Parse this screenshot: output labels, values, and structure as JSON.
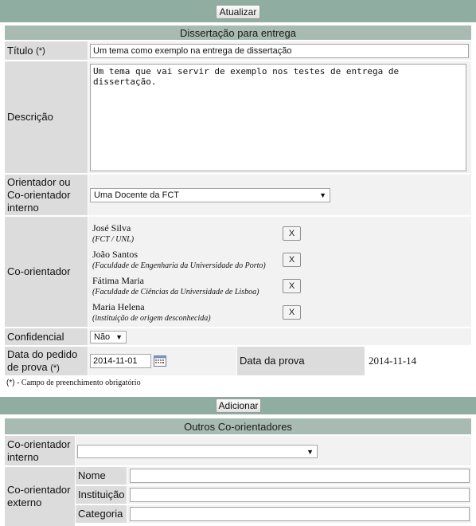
{
  "buttons": {
    "update": "Atualizar",
    "add": "Adicionar"
  },
  "thesis": {
    "title_header": "Dissertação para entrega",
    "title_label": "Título",
    "required_mark": "(*)",
    "title_value": "Um tema como exemplo na entrega de dissertação",
    "description_label": "Descrição",
    "description_value": "Um tema que vai servir de exemplo nos testes de entrega de dissertação.",
    "internal_supervisor_label": "Orientador ou Co-orientador interno",
    "internal_supervisor_value": "Uma Docente da FCT",
    "co_supervisor_label": "Co-orientador",
    "co_supervisors": [
      {
        "name": "José Silva",
        "institution": "(FCT / UNL)",
        "remove": "X"
      },
      {
        "name": "João Santos",
        "institution": "(Faculdade de Engenharia da Universidade do Porto)",
        "remove": "X"
      },
      {
        "name": "Fátima Maria",
        "institution": "(Faculdade de Ciências da Universidade de Lisboa)",
        "remove": "X"
      },
      {
        "name": "Maria Helena",
        "institution": "(instituição de origem desconhecida)",
        "remove": "X"
      }
    ],
    "confidential_label": "Confidencial",
    "confidential_value": "Não",
    "request_date_label": "Data do pedido de prova",
    "request_date_value": "2014-11-01",
    "exam_date_label": "Data da prova",
    "exam_date_value": "2014-11-14",
    "required_note_mark": "(*)",
    "required_note_text": " - Campo de preenchimento obrigatório"
  },
  "others": {
    "title_header": "Outros Co-orientadores",
    "internal_label": "Co-orientador interno",
    "internal_value": "",
    "external_label": "Co-orientador externo",
    "name_label": "Nome",
    "name_value": "",
    "institution_label": "Instituição",
    "institution_value": "",
    "category_label": "Categoria",
    "category_value": ""
  },
  "icons": {
    "calendar": "calendar-icon",
    "dropdown": "chevron-down-icon"
  },
  "colors": {
    "toolbar": "#8fada1",
    "section_header": "#a7bbb2",
    "label_cell": "#dcdcdc",
    "value_cell": "#f2f2f2"
  }
}
